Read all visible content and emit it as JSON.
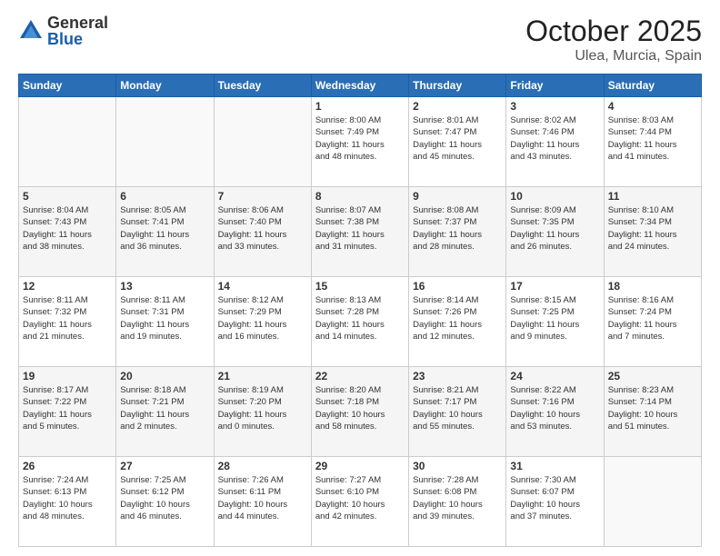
{
  "logo": {
    "general": "General",
    "blue": "Blue"
  },
  "title": "October 2025",
  "location": "Ulea, Murcia, Spain",
  "weekdays": [
    "Sunday",
    "Monday",
    "Tuesday",
    "Wednesday",
    "Thursday",
    "Friday",
    "Saturday"
  ],
  "weeks": [
    [
      {
        "day": "",
        "info": ""
      },
      {
        "day": "",
        "info": ""
      },
      {
        "day": "",
        "info": ""
      },
      {
        "day": "1",
        "info": "Sunrise: 8:00 AM\nSunset: 7:49 PM\nDaylight: 11 hours\nand 48 minutes."
      },
      {
        "day": "2",
        "info": "Sunrise: 8:01 AM\nSunset: 7:47 PM\nDaylight: 11 hours\nand 45 minutes."
      },
      {
        "day": "3",
        "info": "Sunrise: 8:02 AM\nSunset: 7:46 PM\nDaylight: 11 hours\nand 43 minutes."
      },
      {
        "day": "4",
        "info": "Sunrise: 8:03 AM\nSunset: 7:44 PM\nDaylight: 11 hours\nand 41 minutes."
      }
    ],
    [
      {
        "day": "5",
        "info": "Sunrise: 8:04 AM\nSunset: 7:43 PM\nDaylight: 11 hours\nand 38 minutes."
      },
      {
        "day": "6",
        "info": "Sunrise: 8:05 AM\nSunset: 7:41 PM\nDaylight: 11 hours\nand 36 minutes."
      },
      {
        "day": "7",
        "info": "Sunrise: 8:06 AM\nSunset: 7:40 PM\nDaylight: 11 hours\nand 33 minutes."
      },
      {
        "day": "8",
        "info": "Sunrise: 8:07 AM\nSunset: 7:38 PM\nDaylight: 11 hours\nand 31 minutes."
      },
      {
        "day": "9",
        "info": "Sunrise: 8:08 AM\nSunset: 7:37 PM\nDaylight: 11 hours\nand 28 minutes."
      },
      {
        "day": "10",
        "info": "Sunrise: 8:09 AM\nSunset: 7:35 PM\nDaylight: 11 hours\nand 26 minutes."
      },
      {
        "day": "11",
        "info": "Sunrise: 8:10 AM\nSunset: 7:34 PM\nDaylight: 11 hours\nand 24 minutes."
      }
    ],
    [
      {
        "day": "12",
        "info": "Sunrise: 8:11 AM\nSunset: 7:32 PM\nDaylight: 11 hours\nand 21 minutes."
      },
      {
        "day": "13",
        "info": "Sunrise: 8:11 AM\nSunset: 7:31 PM\nDaylight: 11 hours\nand 19 minutes."
      },
      {
        "day": "14",
        "info": "Sunrise: 8:12 AM\nSunset: 7:29 PM\nDaylight: 11 hours\nand 16 minutes."
      },
      {
        "day": "15",
        "info": "Sunrise: 8:13 AM\nSunset: 7:28 PM\nDaylight: 11 hours\nand 14 minutes."
      },
      {
        "day": "16",
        "info": "Sunrise: 8:14 AM\nSunset: 7:26 PM\nDaylight: 11 hours\nand 12 minutes."
      },
      {
        "day": "17",
        "info": "Sunrise: 8:15 AM\nSunset: 7:25 PM\nDaylight: 11 hours\nand 9 minutes."
      },
      {
        "day": "18",
        "info": "Sunrise: 8:16 AM\nSunset: 7:24 PM\nDaylight: 11 hours\nand 7 minutes."
      }
    ],
    [
      {
        "day": "19",
        "info": "Sunrise: 8:17 AM\nSunset: 7:22 PM\nDaylight: 11 hours\nand 5 minutes."
      },
      {
        "day": "20",
        "info": "Sunrise: 8:18 AM\nSunset: 7:21 PM\nDaylight: 11 hours\nand 2 minutes."
      },
      {
        "day": "21",
        "info": "Sunrise: 8:19 AM\nSunset: 7:20 PM\nDaylight: 11 hours\nand 0 minutes."
      },
      {
        "day": "22",
        "info": "Sunrise: 8:20 AM\nSunset: 7:18 PM\nDaylight: 10 hours\nand 58 minutes."
      },
      {
        "day": "23",
        "info": "Sunrise: 8:21 AM\nSunset: 7:17 PM\nDaylight: 10 hours\nand 55 minutes."
      },
      {
        "day": "24",
        "info": "Sunrise: 8:22 AM\nSunset: 7:16 PM\nDaylight: 10 hours\nand 53 minutes."
      },
      {
        "day": "25",
        "info": "Sunrise: 8:23 AM\nSunset: 7:14 PM\nDaylight: 10 hours\nand 51 minutes."
      }
    ],
    [
      {
        "day": "26",
        "info": "Sunrise: 7:24 AM\nSunset: 6:13 PM\nDaylight: 10 hours\nand 48 minutes."
      },
      {
        "day": "27",
        "info": "Sunrise: 7:25 AM\nSunset: 6:12 PM\nDaylight: 10 hours\nand 46 minutes."
      },
      {
        "day": "28",
        "info": "Sunrise: 7:26 AM\nSunset: 6:11 PM\nDaylight: 10 hours\nand 44 minutes."
      },
      {
        "day": "29",
        "info": "Sunrise: 7:27 AM\nSunset: 6:10 PM\nDaylight: 10 hours\nand 42 minutes."
      },
      {
        "day": "30",
        "info": "Sunrise: 7:28 AM\nSunset: 6:08 PM\nDaylight: 10 hours\nand 39 minutes."
      },
      {
        "day": "31",
        "info": "Sunrise: 7:30 AM\nSunset: 6:07 PM\nDaylight: 10 hours\nand 37 minutes."
      },
      {
        "day": "",
        "info": ""
      }
    ]
  ]
}
